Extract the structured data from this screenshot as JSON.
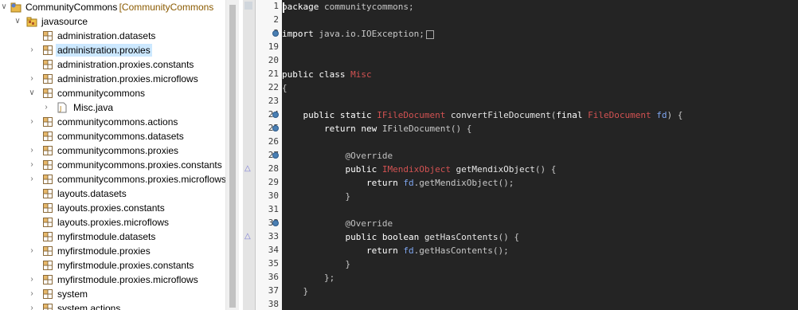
{
  "tree": {
    "items": [
      {
        "label": "CommunityCommons",
        "decoration": "[CommunityCommons",
        "icon": "project-icon",
        "chevron": "down",
        "selected": false
      },
      {
        "label": "javasource",
        "icon": "source-folder-icon",
        "chevron": "down",
        "selected": false
      },
      {
        "label": "administration.datasets",
        "icon": "package-icon",
        "chevron": "",
        "selected": false
      },
      {
        "label": "administration.proxies",
        "icon": "package-icon",
        "chevron": "right",
        "selected": true
      },
      {
        "label": "administration.proxies.constants",
        "icon": "package-icon",
        "chevron": "",
        "selected": false
      },
      {
        "label": "administration.proxies.microflows",
        "icon": "package-icon",
        "chevron": "right",
        "selected": false
      },
      {
        "label": "communitycommons",
        "icon": "package-icon",
        "chevron": "down",
        "selected": false
      },
      {
        "label": "Misc.java",
        "icon": "java-file-icon",
        "chevron": "right",
        "selected": false
      },
      {
        "label": "communitycommons.actions",
        "icon": "package-icon",
        "chevron": "right",
        "selected": false
      },
      {
        "label": "communitycommons.datasets",
        "icon": "package-icon",
        "chevron": "",
        "selected": false
      },
      {
        "label": "communitycommons.proxies",
        "icon": "package-icon",
        "chevron": "right",
        "selected": false
      },
      {
        "label": "communitycommons.proxies.constants",
        "icon": "package-icon",
        "chevron": "right",
        "selected": false
      },
      {
        "label": "communitycommons.proxies.microflows",
        "icon": "package-icon",
        "chevron": "right",
        "selected": false
      },
      {
        "label": "layouts.datasets",
        "icon": "package-icon",
        "chevron": "",
        "selected": false
      },
      {
        "label": "layouts.proxies.constants",
        "icon": "package-icon",
        "chevron": "",
        "selected": false
      },
      {
        "label": "layouts.proxies.microflows",
        "icon": "package-icon",
        "chevron": "",
        "selected": false
      },
      {
        "label": "myfirstmodule.datasets",
        "icon": "package-icon",
        "chevron": "",
        "selected": false
      },
      {
        "label": "myfirstmodule.proxies",
        "icon": "package-icon",
        "chevron": "right",
        "selected": false
      },
      {
        "label": "myfirstmodule.proxies.constants",
        "icon": "package-icon",
        "chevron": "",
        "selected": false
      },
      {
        "label": "myfirstmodule.proxies.microflows",
        "icon": "package-icon",
        "chevron": "right",
        "selected": false
      },
      {
        "label": "system",
        "icon": "package-icon",
        "chevron": "right",
        "selected": false
      },
      {
        "label": "system.actions",
        "icon": "package-icon",
        "chevron": "right",
        "selected": false
      }
    ]
  },
  "editor": {
    "lines": [
      {
        "n": "1",
        "marker": "",
        "tokens": [
          [
            "kw",
            "package"
          ],
          [
            "dk",
            " communitycommons;"
          ]
        ]
      },
      {
        "n": "2",
        "marker": "",
        "tokens": []
      },
      {
        "n": "3",
        "marker": "fold",
        "tokens": [
          [
            "kw",
            "import"
          ],
          [
            "dk",
            " java.io.IOException;"
          ]
        ],
        "folded": true
      },
      {
        "n": "19",
        "marker": "",
        "tokens": []
      },
      {
        "n": "20",
        "marker": "",
        "tokens": []
      },
      {
        "n": "21",
        "marker": "",
        "tokens": [
          [
            "kw",
            "public class "
          ],
          [
            "cls",
            "Misc"
          ]
        ]
      },
      {
        "n": "22",
        "marker": "",
        "tokens": [
          [
            "dk",
            "{"
          ]
        ]
      },
      {
        "n": "23",
        "marker": "",
        "tokens": []
      },
      {
        "n": "24",
        "marker": "fold",
        "tokens": [
          [
            "kw",
            "    public static "
          ],
          [
            "cls",
            "IFileDocument"
          ],
          [
            "fn",
            " convertFileDocument"
          ],
          [
            "dk",
            "("
          ],
          [
            "kw",
            "final "
          ],
          [
            "cls",
            "FileDocument"
          ],
          [
            "var",
            " fd"
          ],
          [
            "dk",
            ") {"
          ]
        ]
      },
      {
        "n": "25",
        "marker": "fold",
        "tokens": [
          [
            "kw",
            "        return new "
          ],
          [
            "dk",
            "IFileDocument() {"
          ]
        ]
      },
      {
        "n": "26",
        "marker": "",
        "tokens": []
      },
      {
        "n": "27",
        "marker": "fold",
        "tokens": [
          [
            "ann",
            "            @Override"
          ]
        ]
      },
      {
        "n": "28",
        "marker": "override",
        "tokens": [
          [
            "kw",
            "            public "
          ],
          [
            "cls",
            "IMendixObject"
          ],
          [
            "fn",
            " getMendixObject"
          ],
          [
            "dk",
            "() {"
          ]
        ]
      },
      {
        "n": "29",
        "marker": "",
        "tokens": [
          [
            "kw",
            "                return "
          ],
          [
            "var",
            "fd"
          ],
          [
            "dk",
            ".getMendixObject();"
          ]
        ]
      },
      {
        "n": "30",
        "marker": "",
        "tokens": [
          [
            "dk",
            "            }"
          ]
        ]
      },
      {
        "n": "31",
        "marker": "",
        "tokens": []
      },
      {
        "n": "32",
        "marker": "fold",
        "tokens": [
          [
            "ann",
            "            @Override"
          ]
        ]
      },
      {
        "n": "33",
        "marker": "override",
        "tokens": [
          [
            "kw",
            "            public boolean "
          ],
          [
            "fn",
            "getHasContents"
          ],
          [
            "dk",
            "() {"
          ]
        ]
      },
      {
        "n": "34",
        "marker": "",
        "tokens": [
          [
            "kw",
            "                return "
          ],
          [
            "var",
            "fd"
          ],
          [
            "dk",
            ".getHasContents();"
          ]
        ]
      },
      {
        "n": "35",
        "marker": "",
        "tokens": [
          [
            "dk",
            "            }"
          ]
        ]
      },
      {
        "n": "36",
        "marker": "",
        "tokens": [
          [
            "dk",
            "        };"
          ]
        ]
      },
      {
        "n": "37",
        "marker": "",
        "tokens": [
          [
            "dk",
            "    }"
          ]
        ]
      },
      {
        "n": "38",
        "marker": "",
        "tokens": []
      }
    ]
  }
}
